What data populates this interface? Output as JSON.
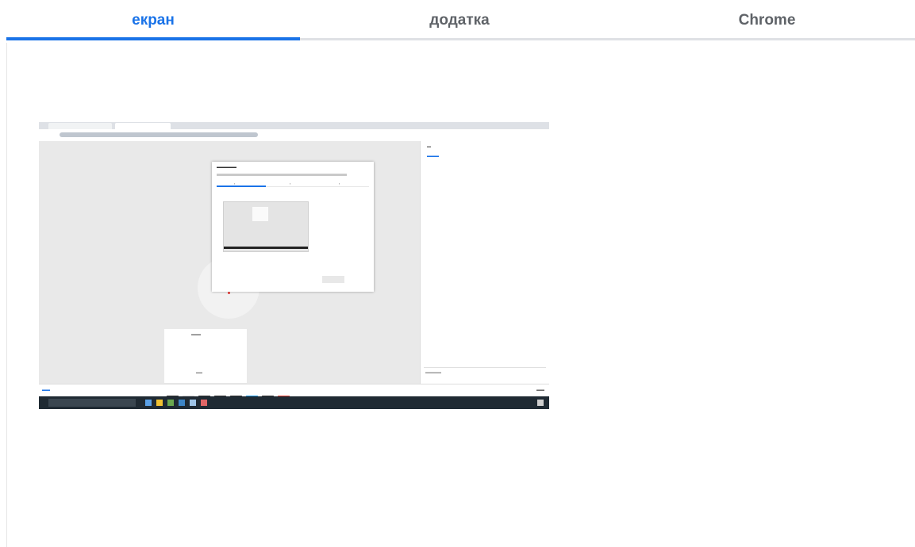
{
  "tabs": [
    {
      "label": "екран",
      "active": true
    },
    {
      "label": "додатка",
      "active": false
    },
    {
      "label": "Chrome",
      "active": false
    }
  ],
  "colors": {
    "accent": "#1a73e8",
    "tab_inactive": "#5f6368",
    "tab_track": "#dfe1e5"
  },
  "screen_thumbnail": {
    "description_icon": "screen-preview-thumbnail"
  }
}
